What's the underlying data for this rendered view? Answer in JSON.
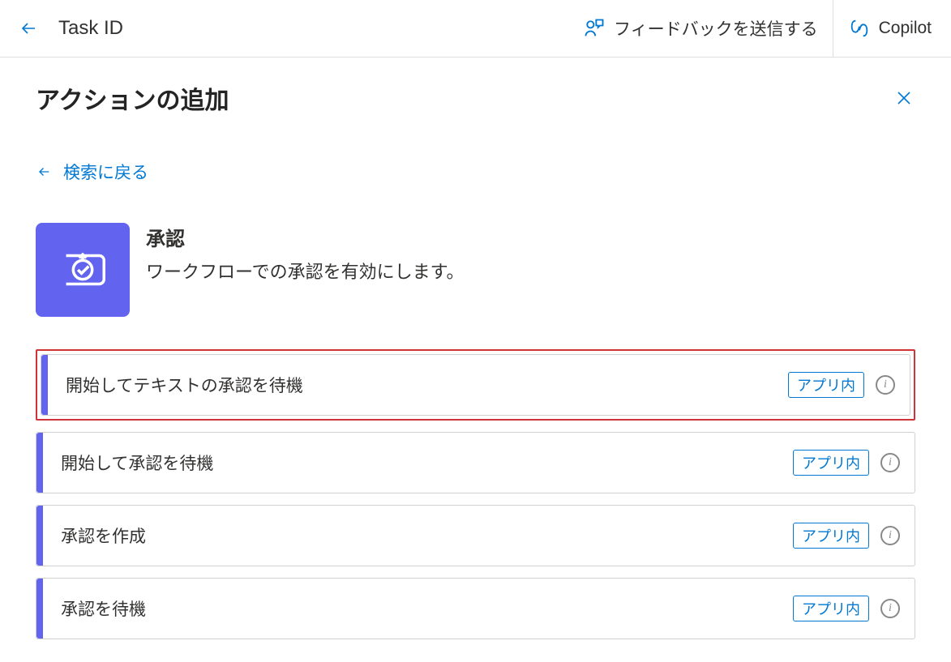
{
  "header": {
    "title": "Task ID",
    "feedback_label": "フィードバックを送信する",
    "copilot_label": "Copilot"
  },
  "panel": {
    "title": "アクションの追加",
    "back_search_label": "検索に戻る"
  },
  "connector": {
    "name": "承認",
    "description": "ワークフローでの承認を有効にします。"
  },
  "actions": [
    {
      "label": "開始してテキストの承認を待機",
      "type": "アプリ内",
      "highlighted": true
    },
    {
      "label": "開始して承認を待機",
      "type": "アプリ内",
      "highlighted": false
    },
    {
      "label": "承認を作成",
      "type": "アプリ内",
      "highlighted": false
    },
    {
      "label": "承認を待機",
      "type": "アプリ内",
      "highlighted": false
    }
  ],
  "info_glyph": "i"
}
